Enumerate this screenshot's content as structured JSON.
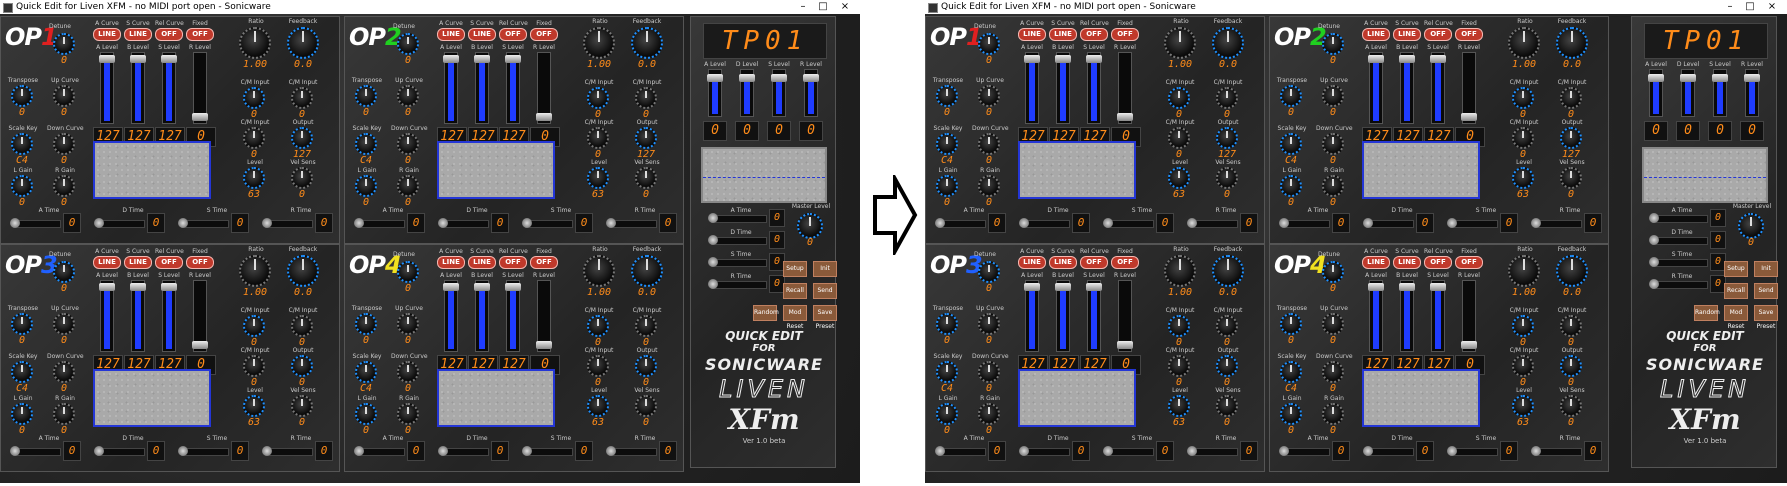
{
  "window": {
    "title": "Quick Edit for Liven XFM - no MIDI port open - Sonicware",
    "controls": [
      "–",
      "□",
      "×"
    ]
  },
  "ops": [
    {
      "label": "OP",
      "num": "1",
      "num_color": "#e02020",
      "fader_values": [
        "127",
        "127",
        "127",
        "0"
      ],
      "ratio": "1.00",
      "feedback": "0.0",
      "trans": "0",
      "up_curve": "0",
      "dn_curve": "0",
      "cm_in": "0",
      "cm_in2": "0",
      "cm_out": "0",
      "output": "127",
      "level": "63",
      "scale_key": "C4",
      "lgain": "0",
      "rgain": "0",
      "velsens": "0",
      "t1": "0",
      "t2": "0",
      "t3": "0",
      "t4": "0"
    },
    {
      "label": "OP",
      "num": "2",
      "num_color": "#20d020",
      "fader_values": [
        "127",
        "127",
        "127",
        "0"
      ],
      "ratio": "1.00",
      "feedback": "0.0",
      "trans": "0",
      "up_curve": "0",
      "dn_curve": "0",
      "cm_in": "0",
      "cm_in2": "0",
      "cm_out": "0",
      "output": "127",
      "level": "63",
      "scale_key": "C4",
      "lgain": "0",
      "rgain": "0",
      "velsens": "0",
      "t1": "0",
      "t2": "0",
      "t3": "0",
      "t4": "0"
    },
    {
      "label": "OP",
      "num": "3",
      "num_color": "#2060ff",
      "fader_values": [
        "127",
        "127",
        "127",
        "0"
      ],
      "ratio": "1.00",
      "feedback": "0.0",
      "trans": "0",
      "up_curve": "0",
      "dn_curve": "0",
      "cm_in": "0",
      "cm_in2": "0",
      "cm_out": "0",
      "output": "0",
      "level": "63",
      "scale_key": "C4",
      "lgain": "0",
      "rgain": "0",
      "velsens": "0",
      "t1": "0",
      "t2": "0",
      "t3": "0",
      "t4": "0"
    },
    {
      "label": "OP",
      "num": "4",
      "num_color": "#f0e020",
      "fader_values": [
        "127",
        "127",
        "127",
        "0"
      ],
      "ratio": "1.00",
      "feedback": "0.0",
      "trans": "0",
      "up_curve": "0",
      "dn_curve": "0",
      "cm_in": "0",
      "cm_in2": "0",
      "cm_out": "0",
      "output": "0",
      "level": "63",
      "scale_key": "C4",
      "lgain": "0",
      "rgain": "0",
      "velsens": "0",
      "t1": "0",
      "t2": "0",
      "t3": "0",
      "t4": "0"
    }
  ],
  "op_labels": {
    "a_level": "A Level",
    "b_level": "B Level",
    "s_level": "S Level",
    "r_level": "R Level",
    "a_curve": "A Curve",
    "s_curve": "S Curve",
    "rel_curve": "Rel Curve",
    "fixed": "Fixed",
    "ratio": "Ratio",
    "feedback": "Feedback",
    "detune": "Detune",
    "transpose": "Transpose",
    "up_curve": "Up Curve",
    "dn_curve": "Down Curve",
    "scale_key": "Scale Key",
    "l_gain": "L Gain",
    "r_gain": "R Gain",
    "cm_input": "C/M Input",
    "output": "Output",
    "level": "Level",
    "vel_sens": "Vel Sens",
    "a_time": "A Time",
    "d_time": "D Time",
    "s_time": "S Time",
    "r_time": "R Time",
    "line": "LINE",
    "off": "OFF"
  },
  "tp": {
    "display": "TP01",
    "levels": [
      "0",
      "0",
      "0",
      "0"
    ],
    "level_labels": [
      "A Level",
      "D Level",
      "S Level",
      "R Level"
    ],
    "times": [
      "0",
      "0",
      "0",
      "0"
    ],
    "time_labels": [
      "A Time",
      "D Time",
      "S Time",
      "R Time"
    ],
    "master_level_label": "Master Level",
    "master_level": "0",
    "buttons": [
      "Setup",
      "Init",
      "Recall",
      "Send",
      "Random",
      "Mod Reset",
      "Save Preset"
    ]
  },
  "brand": {
    "quick_edit": "QUICK EDIT",
    "for": "FOR",
    "sonicware": "SONICWARE",
    "liven": "LIVEN",
    "xfm": "XFm",
    "version": "Ver 1.0 beta"
  }
}
